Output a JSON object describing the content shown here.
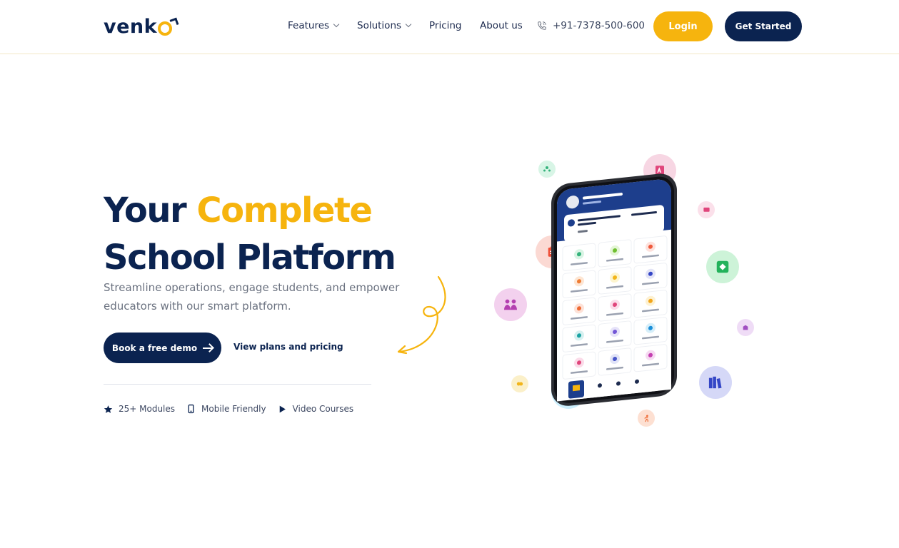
{
  "header": {
    "logo_text": "venk",
    "nav": {
      "features": "Features",
      "solutions": "Solutions",
      "pricing": "Pricing",
      "about": "About us",
      "phone": "+91-7378-500-600"
    },
    "login_label": "Login",
    "get_started_label": "Get Started"
  },
  "hero": {
    "title_part1": "Your",
    "title_accent": "Complete",
    "title_line2": "School Platform",
    "subtitle": "Streamline operations, engage students, and empower educators with our smart platform.",
    "demo_button": "Book a free demo",
    "plans_link": "View plans and pricing",
    "features": [
      {
        "icon": "star-icon",
        "label": "25+ Modules"
      },
      {
        "icon": "mobile-icon",
        "label": "Mobile Friendly"
      },
      {
        "icon": "play-icon",
        "label": "Video Courses"
      }
    ]
  },
  "phone_screen": {
    "user_name": "Anand Deshpande",
    "user_role": "Principal",
    "school_name": "VENKO ENGLISH MEDIUM SCHOOL",
    "school_year": "2023-2024",
    "school_city": "Pune",
    "tiles": [
      "Attendance",
      "Homework",
      "Notice",
      "Students",
      "Staff",
      "Events",
      "Result",
      "Fee",
      "Leave",
      "Online Exam",
      "File Uploads",
      "Birthday",
      "Standards",
      "Classes",
      "Parents"
    ],
    "bottom_nav": [
      "Home",
      "Profile",
      "Help",
      "Start Over"
    ]
  },
  "colors": {
    "brand_navy": "#0b2350",
    "brand_yellow": "#f6b40e"
  }
}
